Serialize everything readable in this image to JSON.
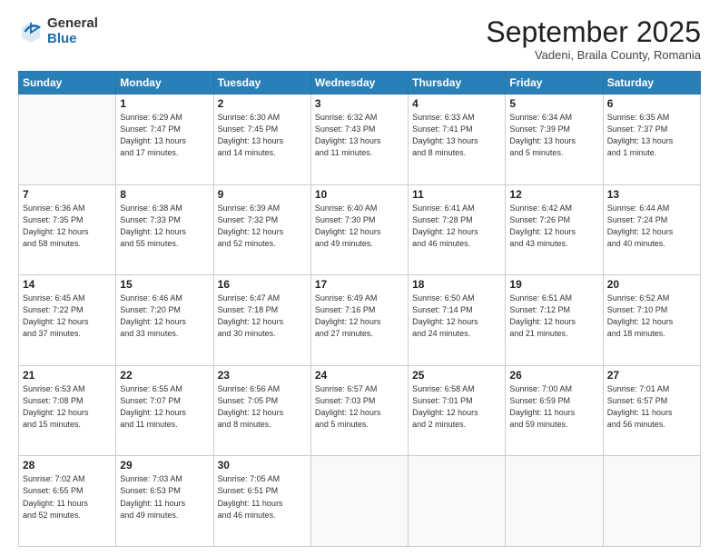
{
  "header": {
    "logo_general": "General",
    "logo_blue": "Blue",
    "month_title": "September 2025",
    "subtitle": "Vadeni, Braila County, Romania"
  },
  "days_of_week": [
    "Sunday",
    "Monday",
    "Tuesday",
    "Wednesday",
    "Thursday",
    "Friday",
    "Saturday"
  ],
  "weeks": [
    [
      {
        "num": "",
        "info": ""
      },
      {
        "num": "1",
        "info": "Sunrise: 6:29 AM\nSunset: 7:47 PM\nDaylight: 13 hours\nand 17 minutes."
      },
      {
        "num": "2",
        "info": "Sunrise: 6:30 AM\nSunset: 7:45 PM\nDaylight: 13 hours\nand 14 minutes."
      },
      {
        "num": "3",
        "info": "Sunrise: 6:32 AM\nSunset: 7:43 PM\nDaylight: 13 hours\nand 11 minutes."
      },
      {
        "num": "4",
        "info": "Sunrise: 6:33 AM\nSunset: 7:41 PM\nDaylight: 13 hours\nand 8 minutes."
      },
      {
        "num": "5",
        "info": "Sunrise: 6:34 AM\nSunset: 7:39 PM\nDaylight: 13 hours\nand 5 minutes."
      },
      {
        "num": "6",
        "info": "Sunrise: 6:35 AM\nSunset: 7:37 PM\nDaylight: 13 hours\nand 1 minute."
      }
    ],
    [
      {
        "num": "7",
        "info": "Sunrise: 6:36 AM\nSunset: 7:35 PM\nDaylight: 12 hours\nand 58 minutes."
      },
      {
        "num": "8",
        "info": "Sunrise: 6:38 AM\nSunset: 7:33 PM\nDaylight: 12 hours\nand 55 minutes."
      },
      {
        "num": "9",
        "info": "Sunrise: 6:39 AM\nSunset: 7:32 PM\nDaylight: 12 hours\nand 52 minutes."
      },
      {
        "num": "10",
        "info": "Sunrise: 6:40 AM\nSunset: 7:30 PM\nDaylight: 12 hours\nand 49 minutes."
      },
      {
        "num": "11",
        "info": "Sunrise: 6:41 AM\nSunset: 7:28 PM\nDaylight: 12 hours\nand 46 minutes."
      },
      {
        "num": "12",
        "info": "Sunrise: 6:42 AM\nSunset: 7:26 PM\nDaylight: 12 hours\nand 43 minutes."
      },
      {
        "num": "13",
        "info": "Sunrise: 6:44 AM\nSunset: 7:24 PM\nDaylight: 12 hours\nand 40 minutes."
      }
    ],
    [
      {
        "num": "14",
        "info": "Sunrise: 6:45 AM\nSunset: 7:22 PM\nDaylight: 12 hours\nand 37 minutes."
      },
      {
        "num": "15",
        "info": "Sunrise: 6:46 AM\nSunset: 7:20 PM\nDaylight: 12 hours\nand 33 minutes."
      },
      {
        "num": "16",
        "info": "Sunrise: 6:47 AM\nSunset: 7:18 PM\nDaylight: 12 hours\nand 30 minutes."
      },
      {
        "num": "17",
        "info": "Sunrise: 6:49 AM\nSunset: 7:16 PM\nDaylight: 12 hours\nand 27 minutes."
      },
      {
        "num": "18",
        "info": "Sunrise: 6:50 AM\nSunset: 7:14 PM\nDaylight: 12 hours\nand 24 minutes."
      },
      {
        "num": "19",
        "info": "Sunrise: 6:51 AM\nSunset: 7:12 PM\nDaylight: 12 hours\nand 21 minutes."
      },
      {
        "num": "20",
        "info": "Sunrise: 6:52 AM\nSunset: 7:10 PM\nDaylight: 12 hours\nand 18 minutes."
      }
    ],
    [
      {
        "num": "21",
        "info": "Sunrise: 6:53 AM\nSunset: 7:08 PM\nDaylight: 12 hours\nand 15 minutes."
      },
      {
        "num": "22",
        "info": "Sunrise: 6:55 AM\nSunset: 7:07 PM\nDaylight: 12 hours\nand 11 minutes."
      },
      {
        "num": "23",
        "info": "Sunrise: 6:56 AM\nSunset: 7:05 PM\nDaylight: 12 hours\nand 8 minutes."
      },
      {
        "num": "24",
        "info": "Sunrise: 6:57 AM\nSunset: 7:03 PM\nDaylight: 12 hours\nand 5 minutes."
      },
      {
        "num": "25",
        "info": "Sunrise: 6:58 AM\nSunset: 7:01 PM\nDaylight: 12 hours\nand 2 minutes."
      },
      {
        "num": "26",
        "info": "Sunrise: 7:00 AM\nSunset: 6:59 PM\nDaylight: 11 hours\nand 59 minutes."
      },
      {
        "num": "27",
        "info": "Sunrise: 7:01 AM\nSunset: 6:57 PM\nDaylight: 11 hours\nand 56 minutes."
      }
    ],
    [
      {
        "num": "28",
        "info": "Sunrise: 7:02 AM\nSunset: 6:55 PM\nDaylight: 11 hours\nand 52 minutes."
      },
      {
        "num": "29",
        "info": "Sunrise: 7:03 AM\nSunset: 6:53 PM\nDaylight: 11 hours\nand 49 minutes."
      },
      {
        "num": "30",
        "info": "Sunrise: 7:05 AM\nSunset: 6:51 PM\nDaylight: 11 hours\nand 46 minutes."
      },
      {
        "num": "",
        "info": ""
      },
      {
        "num": "",
        "info": ""
      },
      {
        "num": "",
        "info": ""
      },
      {
        "num": "",
        "info": ""
      }
    ]
  ]
}
